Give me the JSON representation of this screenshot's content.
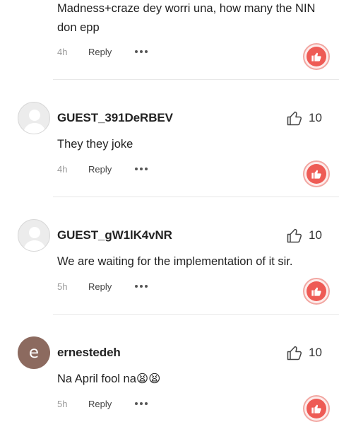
{
  "comments": [
    {
      "username": "",
      "text": "Madness+craze dey worri una, how many the NIN don epp",
      "time": "4h",
      "reply_label": "Reply",
      "likes": ""
    },
    {
      "username": "GUEST_391DeRBEV",
      "text": "They they joke",
      "time": "4h",
      "reply_label": "Reply",
      "likes": "10",
      "avatar_type": "default"
    },
    {
      "username": "GUEST_gW1lK4vNR",
      "text": "We are waiting for the implementation of it sir.",
      "time": "5h",
      "reply_label": "Reply",
      "likes": "10",
      "avatar_type": "default"
    },
    {
      "username": "ernestedeh",
      "text": "Na April fool na😫😫",
      "time": "5h",
      "reply_label": "Reply",
      "likes": "10",
      "avatar_type": "letter",
      "avatar_letter": "e",
      "avatar_color": "#8c6a5f"
    }
  ],
  "icons": {
    "like": "thumbs-up-outline-icon",
    "more": "more-dots-icon",
    "reaction": "thumbs-up-reaction-icon"
  },
  "colors": {
    "reaction_accent": "#ee5b55",
    "divider": "#e8e8e8"
  }
}
